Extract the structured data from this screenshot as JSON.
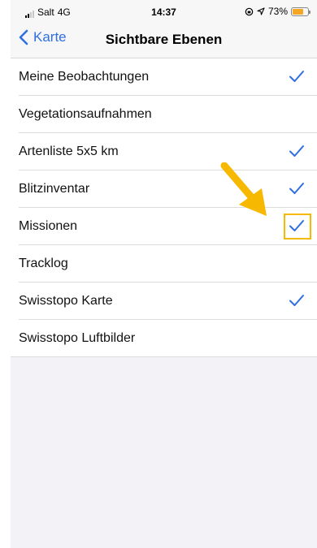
{
  "status_bar": {
    "carrier": "Salt",
    "network": "4G",
    "time": "14:37",
    "battery_percent": "73%",
    "battery_level": 0.73,
    "battery_color": "#f5a623"
  },
  "nav": {
    "back_label": "Karte",
    "title": "Sichtbare Ebenen"
  },
  "layers": [
    {
      "label": "Meine Beobachtungen",
      "checked": true
    },
    {
      "label": "Vegetationsaufnahmen",
      "checked": false
    },
    {
      "label": "Artenliste 5x5 km",
      "checked": true
    },
    {
      "label": "Blitzinventar",
      "checked": true
    },
    {
      "label": "Missionen",
      "checked": true
    },
    {
      "label": "Tracklog",
      "checked": false
    },
    {
      "label": "Swisstopo Karte",
      "checked": true
    },
    {
      "label": "Swisstopo Luftbilder",
      "checked": false
    }
  ],
  "annotation": {
    "target_layer": "Missionen",
    "color": "#f6b800"
  },
  "colors": {
    "accent": "#2f6fe0",
    "background": "#f2f2f7"
  }
}
